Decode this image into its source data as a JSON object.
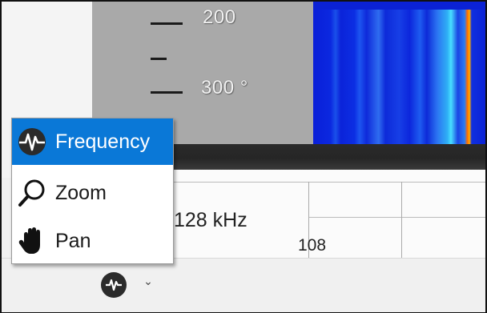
{
  "axis": {
    "ticks": [
      "200",
      "300 °"
    ]
  },
  "grid": {
    "frequency_label": "128 kHz",
    "bottom_value": "108"
  },
  "menu": {
    "items": [
      {
        "label": "Frequency",
        "icon": "frequency-icon",
        "selected": true
      },
      {
        "label": "Zoom",
        "icon": "zoom-icon",
        "selected": false
      },
      {
        "label": "Pan",
        "icon": "pan-hand-icon",
        "selected": false
      }
    ]
  },
  "toolbar": {
    "mode_icon": "frequency-icon",
    "dropdown_icon": "chevron-down-icon",
    "chevron": "⌄"
  },
  "colors": {
    "selection": "#0a78d7",
    "spectrogram_base": "#0b22d5",
    "axis_background": "#a9a9a9"
  }
}
